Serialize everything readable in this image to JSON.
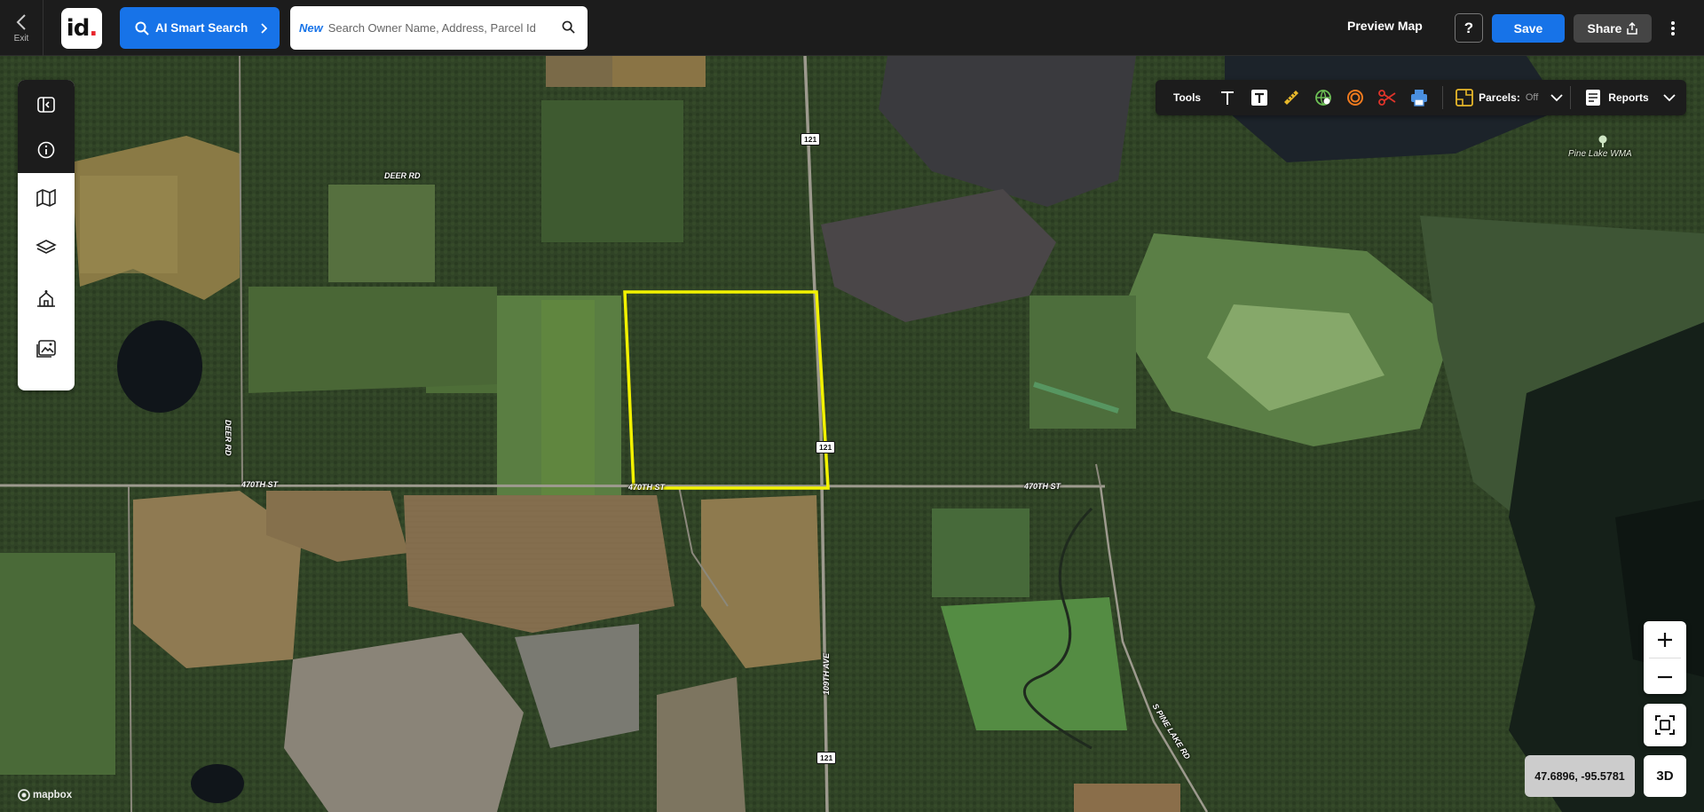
{
  "topbar": {
    "exit_label": "Exit",
    "logo_text": "id",
    "logo_dot": ".",
    "ai_search_label": "AI Smart Search",
    "search_new_label": "New",
    "search_placeholder": "Search Owner Name, Address, Parcel Id",
    "preview_map_label": "Preview Map",
    "help_label": "?",
    "save_label": "Save",
    "share_label": "Share"
  },
  "left_panel": {
    "items": [
      {
        "icon": "panel-toggle-icon"
      },
      {
        "icon": "info-icon"
      },
      {
        "icon": "map-icon"
      },
      {
        "icon": "layers-icon"
      },
      {
        "icon": "property-icon"
      },
      {
        "icon": "image-icon"
      }
    ]
  },
  "tools": {
    "label": "Tools",
    "items": [
      "text-tool-icon",
      "text-box-tool-icon",
      "ruler-icon",
      "globe-pin-icon",
      "radius-icon",
      "scissors-icon",
      "print-icon"
    ],
    "parcels_label": "Parcels:",
    "parcels_state": "Off",
    "reports_label": "Reports"
  },
  "map": {
    "road_labels": [
      "DEER RD",
      "DEER RD",
      "470TH ST",
      "470TH ST",
      "470TH ST",
      "109TH AVE",
      "S PINE LAKE RD"
    ],
    "shields": [
      "121",
      "121",
      "121"
    ],
    "poi": "Pine Lake WMA",
    "attribution": "mapbox",
    "coordinates": "47.6896, -95.5781",
    "btn_3d": "3D"
  },
  "colors": {
    "accent": "#1773e8",
    "parcel_outline": "#f2f200",
    "topbar": "#1c1c1c"
  }
}
